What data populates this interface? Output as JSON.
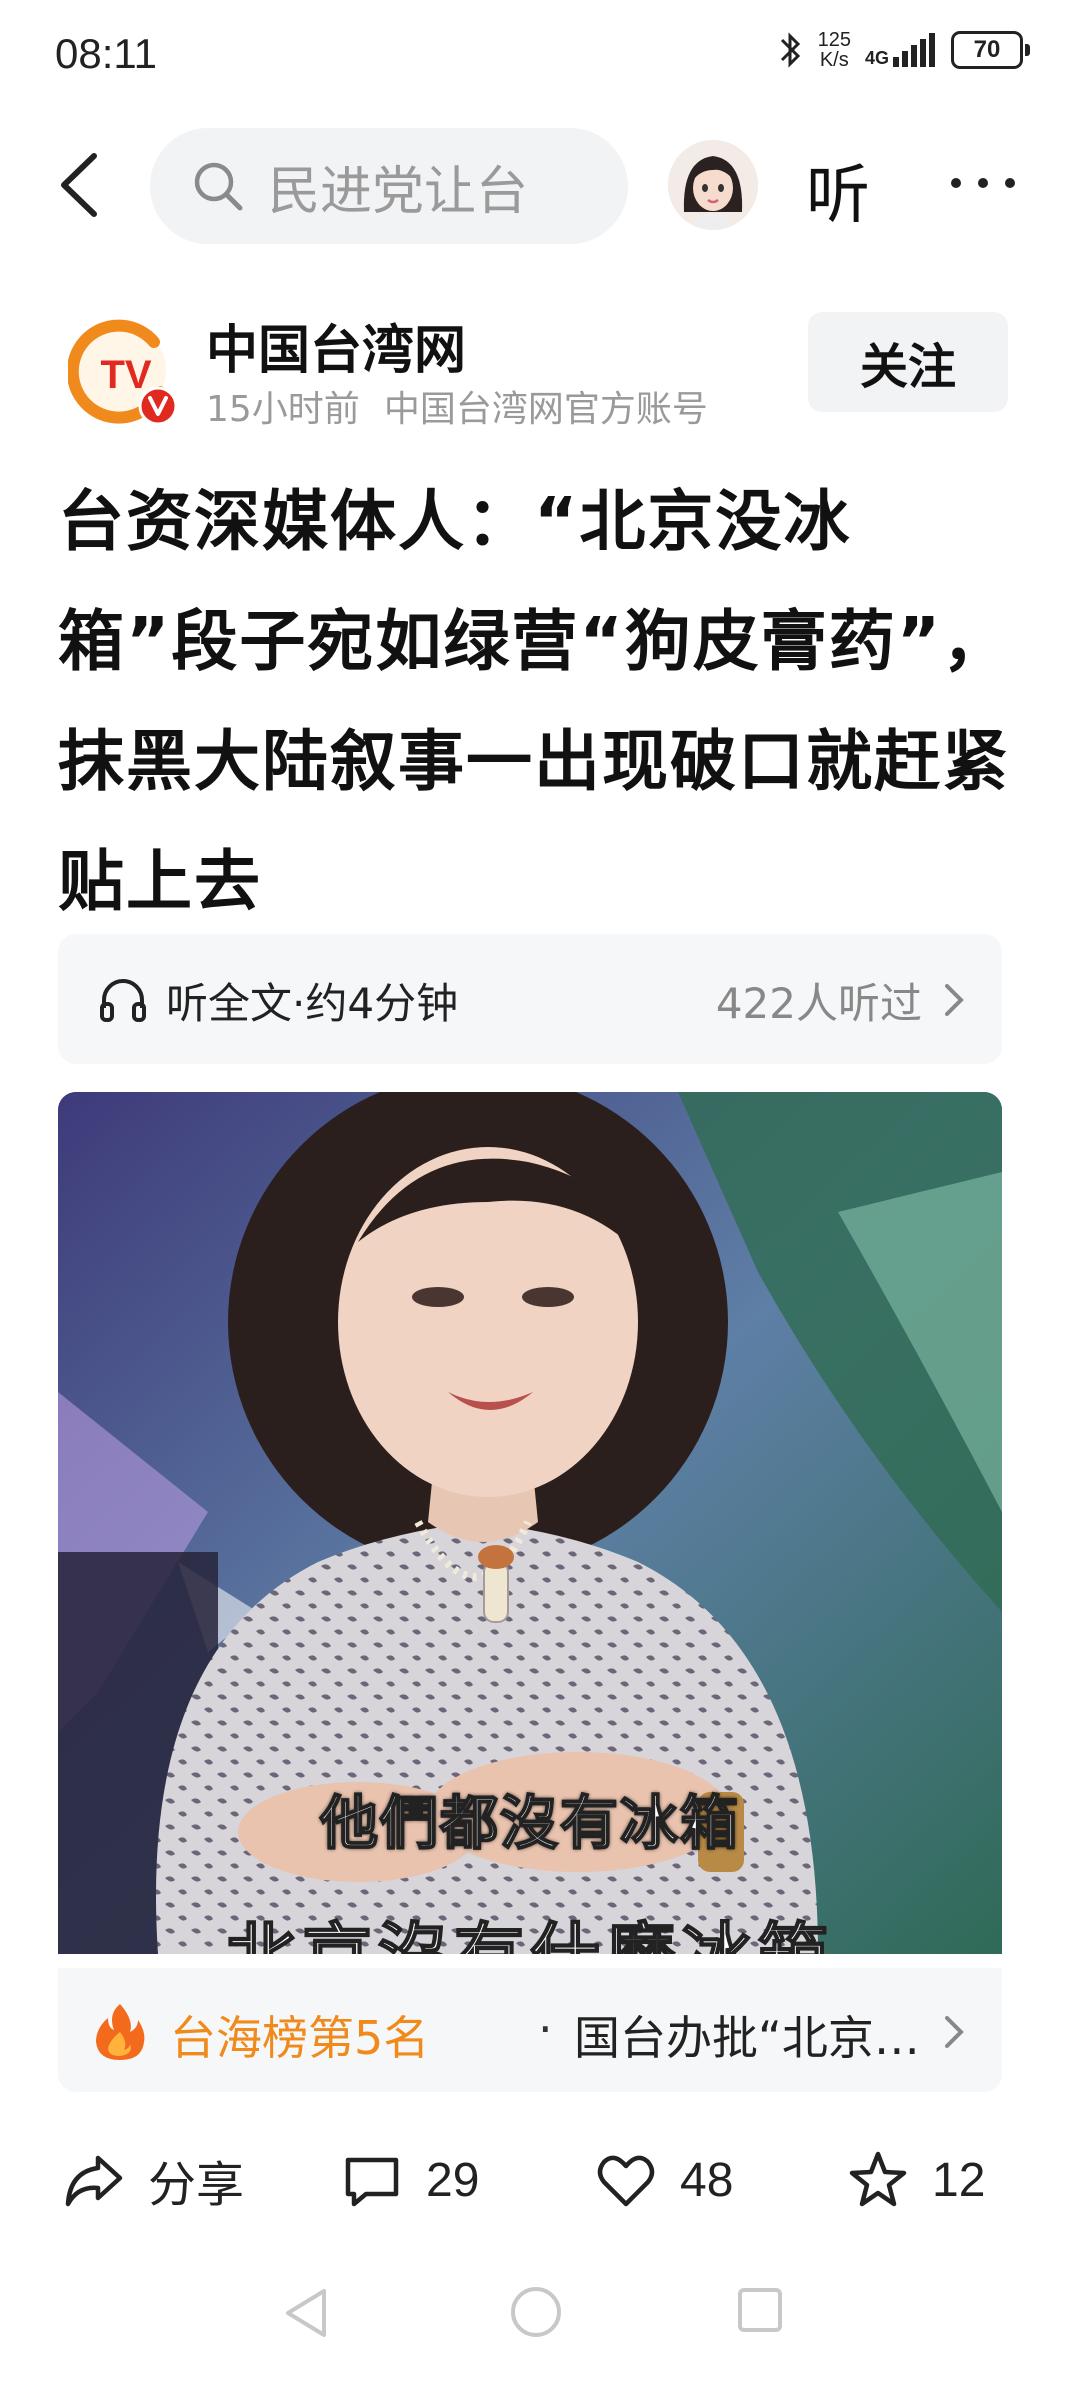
{
  "status_bar": {
    "time": "08:11",
    "net_speed_value": "125",
    "net_speed_unit": "K/s",
    "signal_label": "4G",
    "battery": "70"
  },
  "topbar": {
    "search_text": "民进党让台",
    "listen_label": "听"
  },
  "account": {
    "name": "中国台湾网",
    "time_ago": "15小时前",
    "desc": "中国台湾网官方账号",
    "follow_label": "关注",
    "logo_letters": "TV"
  },
  "article": {
    "title": "台资深媒体人：“北京没冰箱”段子宛如绿营“狗皮膏药”，抹黑大陆叙事一出现破口就赶紧贴上去"
  },
  "listen_bar": {
    "label": "听全文·约4分钟",
    "count": "422人听过"
  },
  "hero_image": {
    "caption": "他們都沒有冰箱",
    "caption_cut": "北京沒有什麼冰箱"
  },
  "rank_bar": {
    "rank_label": "台海榜第5名",
    "separator": "·",
    "topic": "国台办批“北京…"
  },
  "actions": {
    "share_label": "分享",
    "comments": "29",
    "likes": "48",
    "favorites": "12"
  },
  "colors": {
    "accent_orange": "#f08a1c",
    "logo_red": "#e02a20",
    "bg_gray": "#f6f7f8"
  }
}
